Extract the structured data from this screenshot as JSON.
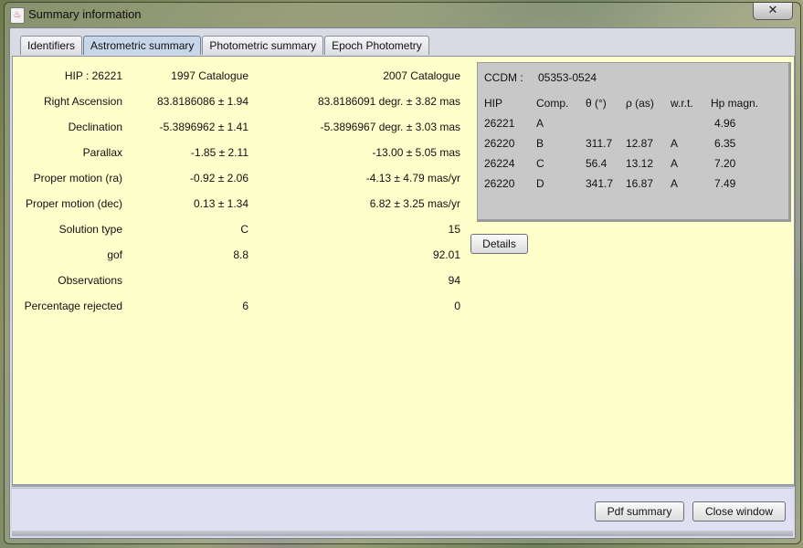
{
  "window": {
    "title": "Summary information",
    "close_glyph": "✕"
  },
  "tabs": [
    {
      "label": "Identifiers",
      "active": false
    },
    {
      "label": "Astrometric summary",
      "active": true
    },
    {
      "label": "Photometric summary",
      "active": false
    },
    {
      "label": "Epoch Photometry",
      "active": false
    }
  ],
  "astrometric": {
    "header": {
      "label": "HIP : 26221",
      "col1997": "1997 Catalogue",
      "col2007": "2007 Catalogue"
    },
    "rows": [
      {
        "label": "Right Ascension",
        "v1997": "83.8186086 ±  1.94",
        "v2007": "83.8186091 degr. ±  3.82 mas"
      },
      {
        "label": "Declination",
        "v1997": "-5.3896962 ±  1.41",
        "v2007": "-5.3896967 degr. ±  3.03 mas"
      },
      {
        "label": "Parallax",
        "v1997": "-1.85 ±  2.11",
        "v2007": "-13.00 ±  5.05 mas"
      },
      {
        "label": "Proper motion (ra)",
        "v1997": "-0.92 ±  2.06",
        "v2007": "-4.13 ±  4.79 mas/yr"
      },
      {
        "label": "Proper motion (dec)",
        "v1997": "0.13 ±  1.34",
        "v2007": "6.82 ±  3.25 mas/yr"
      },
      {
        "label": "Solution type",
        "v1997": "C",
        "v2007": "15"
      },
      {
        "label": "gof",
        "v1997": "8.8",
        "v2007": "92.01"
      },
      {
        "label": "Observations",
        "v1997": "",
        "v2007": "94"
      },
      {
        "label": "Percentage rejected",
        "v1997": "6",
        "v2007": "0"
      }
    ]
  },
  "ccdm": {
    "label": "CCDM :",
    "value": "05353-0524",
    "columns": [
      "HIP",
      "Comp.",
      "θ (°)",
      "ρ (as)",
      "w.r.t.",
      "Hp magn."
    ],
    "rows": [
      [
        "26221",
        "A",
        "",
        "",
        "",
        "4.96"
      ],
      [
        "26220",
        "B",
        "311.7",
        "12.87",
        "A",
        "6.35"
      ],
      [
        "26224",
        "C",
        "56.4",
        "13.12",
        "A",
        "7.20"
      ],
      [
        "26220",
        "D",
        "341.7",
        "16.87",
        "A",
        "7.49"
      ]
    ]
  },
  "buttons": {
    "details": "Details",
    "pdf_summary": "Pdf summary",
    "close_window": "Close window"
  }
}
